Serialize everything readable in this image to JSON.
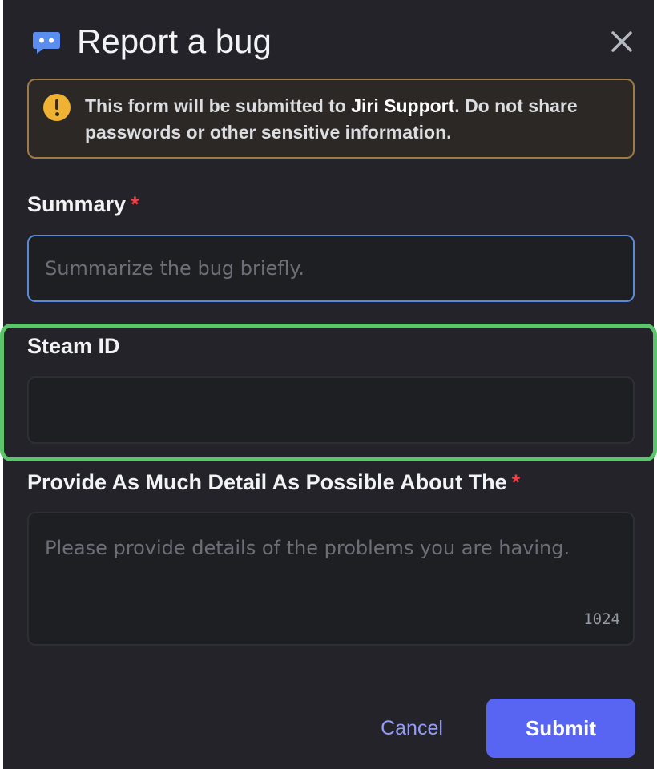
{
  "modal": {
    "title": "Report a bug",
    "app_icon": "chat-bubble-icon",
    "close_icon": "close-icon"
  },
  "notice": {
    "icon": "warning-icon",
    "text_prefix": "This form will be submitted to ",
    "text_strong": "Jiri Support",
    "text_suffix": ". Do not share passwords or other sensitive information."
  },
  "fields": {
    "summary": {
      "label": "Summary",
      "required_mark": "*",
      "value": "",
      "placeholder": "Summarize the bug briefly."
    },
    "steam_id": {
      "label": "Steam ID",
      "value": "",
      "placeholder": ""
    },
    "details": {
      "label": "Provide As Much Detail As Possible About The",
      "required_mark": "*",
      "value": "",
      "placeholder": "Please provide details of the problems you are having.",
      "char_count": "1024"
    }
  },
  "footer": {
    "cancel_label": "Cancel",
    "submit_label": "Submit"
  },
  "colors": {
    "background": "#232329",
    "accent": "#5865f2",
    "link": "#949cf7",
    "required": "#f23f43",
    "warning": "#f0b232",
    "highlight": "#5cc46a"
  }
}
